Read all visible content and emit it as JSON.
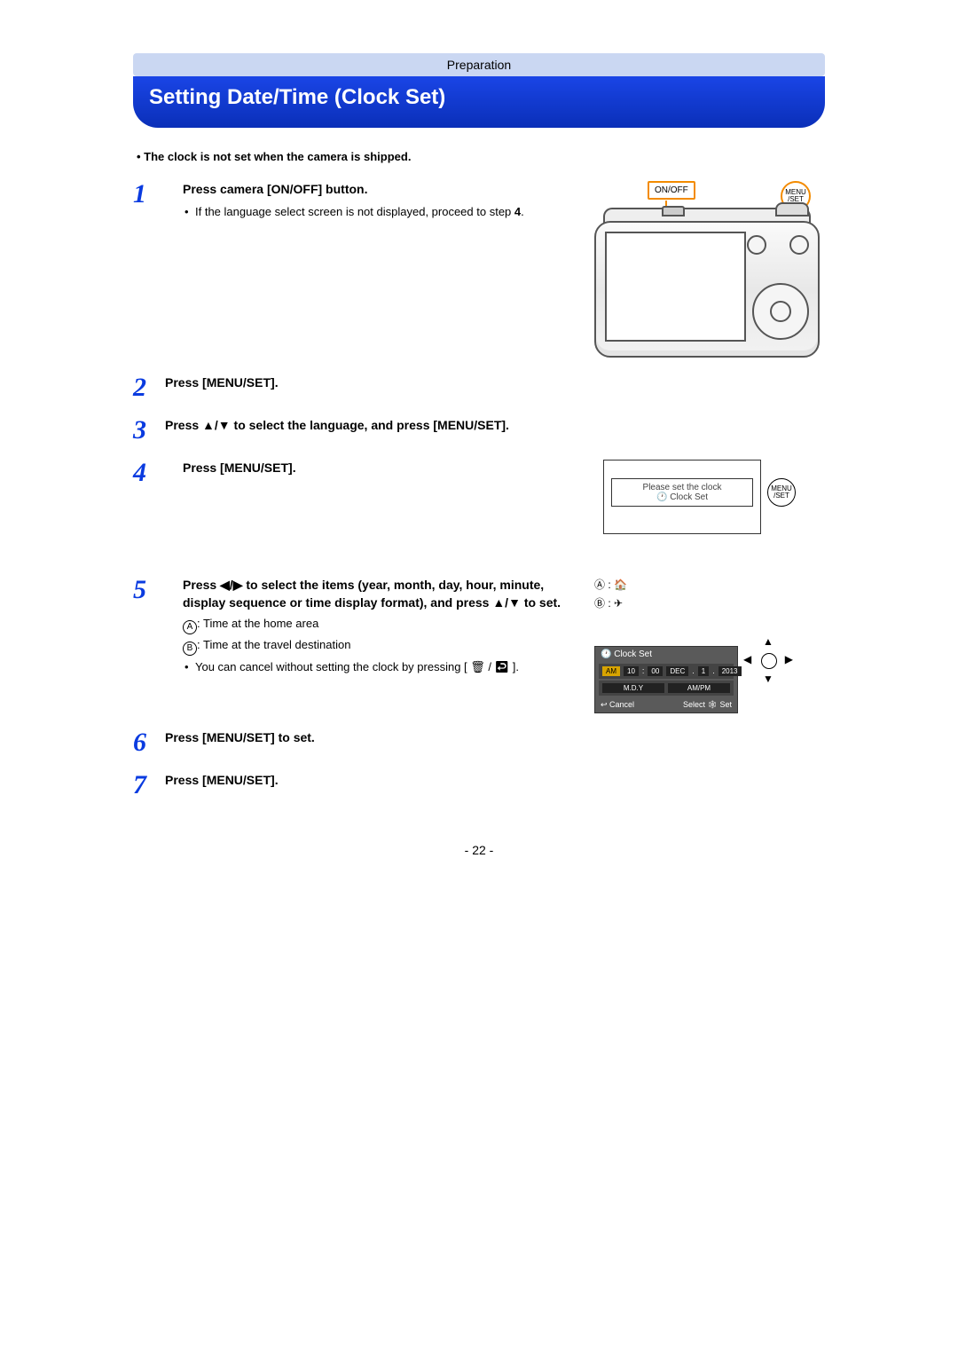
{
  "breadcrumb": "Preparation",
  "title": "Setting Date/Time (Clock Set)",
  "intro_bullet": "The clock is not set when the camera is shipped.",
  "steps": {
    "s1": {
      "num": "1",
      "head": "Press camera [ON/OFF] button.",
      "sub1_a": "If the language select screen is not displayed, proceed to step ",
      "sub1_b": "4",
      "sub1_c": ".",
      "callout_onoff": "ON/OFF",
      "callout_menuset": "MENU\n/SET"
    },
    "s2": {
      "num": "2",
      "head": "Press [MENU/SET]."
    },
    "s3": {
      "num": "3",
      "head": "Press ▲/▼ to select the language, and press [MENU/SET]."
    },
    "s4": {
      "num": "4",
      "head": "Press [MENU/SET].",
      "fig_line1": "Please set the clock",
      "fig_line2": "🕐 Clock Set",
      "menuset_icon": "MENU\n/SET"
    },
    "s5": {
      "num": "5",
      "head": "Press ◀/▶ to select the items (year, month, day, hour, minute, display sequence or time display format), and press ▲/▼ to set.",
      "la": "A",
      "lah": ": Time at the home area",
      "lb": "B",
      "lbh": ": Time at the travel destination",
      "cancel": "You can cancel without setting the clock by pressing [ 🗑 / ↩ ].",
      "ab_a": "Ⓐ : 🏠",
      "ab_b": "Ⓑ : ✈",
      "cs_title": "🕐 Clock Set",
      "cs_cells": [
        "AM",
        "10",
        ":",
        "00",
        "DEC",
        ".",
        "1",
        ".",
        "2013"
      ],
      "cs_fmt1": "M.D.Y",
      "cs_fmt2": "AM/PM",
      "cs_cancel": "↩ Cancel",
      "cs_select": "Select 🕸 Set"
    },
    "s6": {
      "num": "6",
      "head": "Press [MENU/SET] to set."
    },
    "s7": {
      "num": "7",
      "head": "Press [MENU/SET]."
    }
  },
  "page_number": "- 22 -"
}
